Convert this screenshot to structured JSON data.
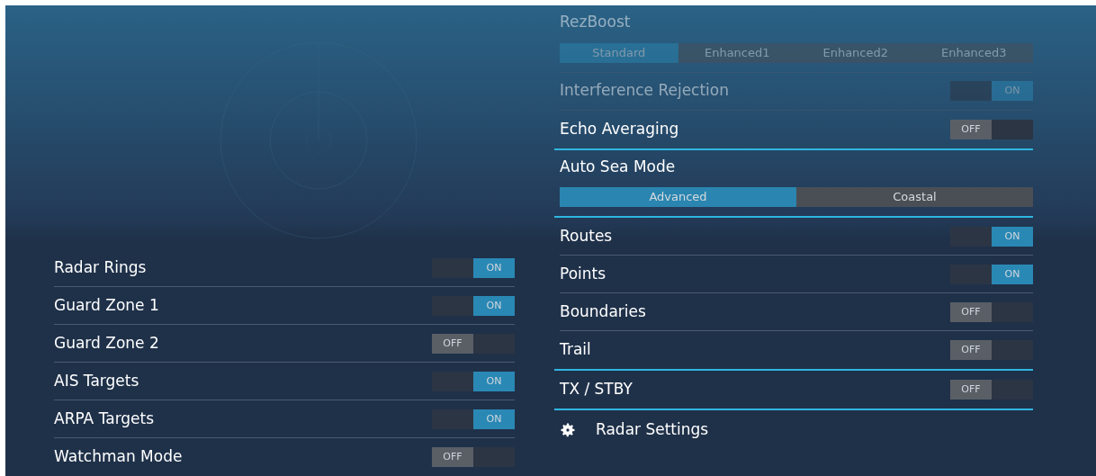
{
  "left_panel": {
    "items": [
      {
        "label": "Radar Rings",
        "on": true,
        "switch_text": "ON"
      },
      {
        "label": "Guard Zone 1",
        "on": true,
        "switch_text": "ON"
      },
      {
        "label": "Guard Zone 2",
        "on": false,
        "switch_text": "OFF"
      },
      {
        "label": "AIS Targets",
        "on": true,
        "switch_text": "ON"
      },
      {
        "label": "ARPA Targets",
        "on": true,
        "switch_text": "ON"
      },
      {
        "label": "Watchman Mode",
        "on": false,
        "switch_text": "OFF"
      }
    ]
  },
  "right_panel": {
    "groups": [
      {
        "items": [
          {
            "kind": "segmented",
            "label": "RezBoost",
            "disabled": true,
            "options": [
              {
                "label": "Standard",
                "selected": true
              },
              {
                "label": "Enhanced1",
                "selected": false
              },
              {
                "label": "Enhanced2",
                "selected": false
              },
              {
                "label": "Enhanced3",
                "selected": false
              }
            ]
          },
          {
            "kind": "toggle",
            "label": "Interference Rejection",
            "disabled": true,
            "on": true,
            "switch_text": "ON"
          },
          {
            "kind": "toggle",
            "label": "Echo Averaging",
            "disabled": false,
            "on": false,
            "switch_text": "OFF"
          }
        ]
      },
      {
        "items": [
          {
            "kind": "segmented",
            "label": "Auto Sea Mode",
            "disabled": false,
            "options": [
              {
                "label": "Advanced",
                "selected": true
              },
              {
                "label": "Coastal",
                "selected": false
              }
            ]
          }
        ]
      },
      {
        "items": [
          {
            "kind": "toggle",
            "label": "Routes",
            "disabled": false,
            "on": true,
            "switch_text": "ON"
          },
          {
            "kind": "toggle",
            "label": "Points",
            "disabled": false,
            "on": true,
            "switch_text": "ON"
          },
          {
            "kind": "toggle",
            "label": "Boundaries",
            "disabled": false,
            "on": false,
            "switch_text": "OFF"
          },
          {
            "kind": "toggle",
            "label": "Trail",
            "disabled": false,
            "on": false,
            "switch_text": "OFF"
          }
        ]
      },
      {
        "items": [
          {
            "kind": "toggle",
            "label": "TX / STBY",
            "disabled": false,
            "on": false,
            "switch_text": "OFF"
          }
        ]
      },
      {
        "items": [
          {
            "kind": "link",
            "label": "Radar Settings",
            "disabled": false
          }
        ]
      }
    ]
  }
}
